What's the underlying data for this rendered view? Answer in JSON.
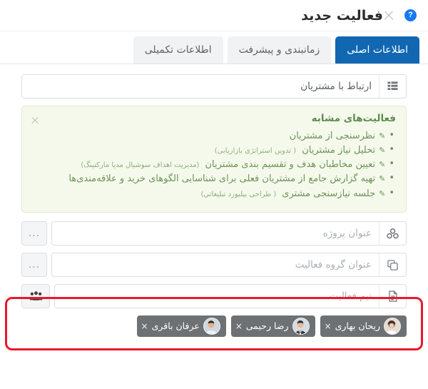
{
  "header": {
    "title": "فعالیت جدید",
    "help_icon": "help-circle-icon",
    "help_glyph": "؟",
    "close_icon": "close-icon"
  },
  "tabs": [
    {
      "label": "اطلاعات اصلی",
      "active": true
    },
    {
      "label": "زمانبندی و پیشرفت",
      "active": false
    },
    {
      "label": "اطلاعات تکمیلی",
      "active": false
    }
  ],
  "fields": {
    "activity_type": {
      "icon": "table-list-icon",
      "value": "ارتباط با مشتریان",
      "placeholder": "ارتباط با مشتریان"
    },
    "project": {
      "icon": "cubes-icon",
      "value": "",
      "placeholder": "عنوان پروژه",
      "more_button": "..."
    },
    "activity_group": {
      "icon": "copy-icon",
      "value": "",
      "placeholder": "عنوان گروه فعالیت",
      "more_button": "..."
    },
    "activity_team": {
      "icon": "document-icon",
      "value": "",
      "placeholder": "تیم فعالیت",
      "team_button_icon": "users-group-icon"
    }
  },
  "similar_activities": {
    "title": "فعالیت‌های مشابه",
    "close_icon": "close-icon",
    "items": [
      {
        "bullet": "•",
        "edit_icon": "pencil-square-icon",
        "text": "نظرسنجی از مشتریان",
        "note": ""
      },
      {
        "bullet": "•",
        "edit_icon": "pencil-square-icon",
        "text": "تحلیل نیاز مشتریان",
        "note": "( تدوین استراتژی بازاریابی)"
      },
      {
        "bullet": "•",
        "edit_icon": "pencil-square-icon",
        "text": "تعیین مخاطبان هدف و تقسیم بندی مشتریان",
        "note": "(مدیریت اهداف سوشیال مدیا مارکتینگ)"
      },
      {
        "bullet": "•",
        "edit_icon": "pencil-square-icon",
        "text": "تهیه گزارش جامع از مشتریان فعلی برای شناسایی الگوهای خرید و علاقه‌مندی‌ها",
        "note": ""
      },
      {
        "bullet": "•",
        "edit_icon": "pencil-square-icon",
        "text": "جلسه نیازسنجی مشتری",
        "note": "( طراحی بیلبورد تبلیغاتی)"
      }
    ]
  },
  "team_members": [
    {
      "name": "ریحان بهاری",
      "remove": "×",
      "avatar": "avatar-female-1"
    },
    {
      "name": "رضا رحیمی",
      "remove": "×",
      "avatar": "avatar-male-1"
    },
    {
      "name": "عرفان باقری",
      "remove": "×",
      "avatar": "avatar-male-2"
    }
  ],
  "colors": {
    "tab_active": "#1167b1",
    "alert_bg": "#f5f9ec",
    "alert_text": "#6b9456",
    "chip_bg": "#6e7174",
    "highlight": "#e9192b",
    "help_blue": "#1877f2"
  }
}
